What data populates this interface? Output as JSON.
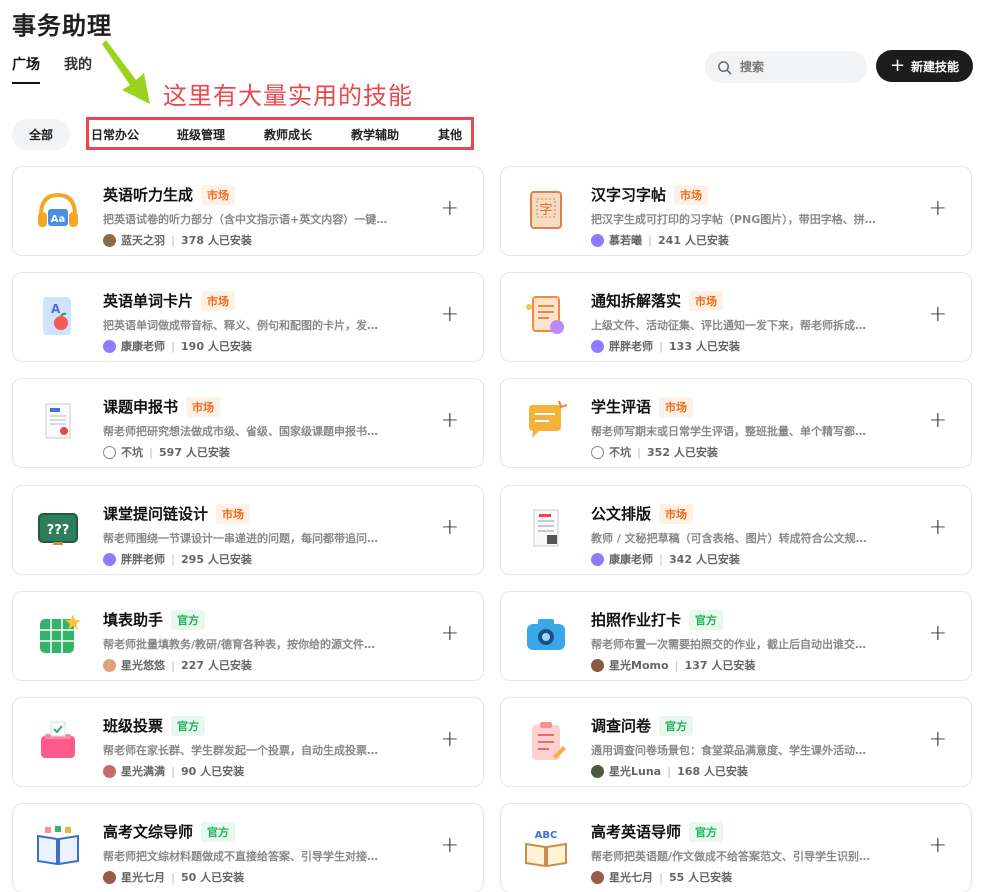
{
  "page_title": "事务助理",
  "tabs": [
    "广场",
    "我的"
  ],
  "search": {
    "placeholder": "搜索"
  },
  "new_button": "新建技能",
  "annotation": "这里有大量实用的技能",
  "filters": {
    "all": "全部",
    "items": [
      "日常办公",
      "班级管理",
      "教师成长",
      "教学辅助",
      "其他"
    ]
  },
  "colors": {
    "market_badge": "#f06a1b",
    "official_badge": "#1fb35a",
    "annotation": "#e8484e",
    "primary_button": "#1c1c1c"
  },
  "cards": [
    {
      "title": "英语听力生成",
      "badge": "市场",
      "badge_type": "market",
      "desc": "把英语试卷的听力部分（含中文指示语+英文内容）一键…",
      "author": "蓝天之羽",
      "installs": "378 人已安装",
      "icon": "headphones-icon"
    },
    {
      "title": "汉字习字帖",
      "badge": "市场",
      "badge_type": "market",
      "desc": "把汉字生成可打印的习字帖（PNG图片），带田字格、拼…",
      "author": "慕若曦",
      "installs": "241 人已安装",
      "icon": "character-copybook-icon"
    },
    {
      "title": "英语单词卡片",
      "badge": "市场",
      "badge_type": "market",
      "desc": "把英语单词做成带音标、释义、例句和配图的卡片，发…",
      "author": "康康老师",
      "installs": "190 人已安装",
      "icon": "word-card-icon"
    },
    {
      "title": "通知拆解落实",
      "badge": "市场",
      "badge_type": "market",
      "desc": "上级文件、活动征集、评比通知一发下来，帮老师拆成…",
      "author": "胖胖老师",
      "installs": "133 人已安装",
      "icon": "notice-icon"
    },
    {
      "title": "课题申报书",
      "badge": "市场",
      "badge_type": "market",
      "desc": "帮老师把研究想法做成市级、省级、国家级课题申报书…",
      "author": "不坑",
      "installs": "597 人已安装",
      "icon": "document-icon"
    },
    {
      "title": "学生评语",
      "badge": "市场",
      "badge_type": "market",
      "desc": "帮老师写期末或日常学生评语，整班批量、单个精写都…",
      "author": "不坑",
      "installs": "352 人已安装",
      "icon": "comment-icon"
    },
    {
      "title": "课堂提问链设计",
      "badge": "市场",
      "badge_type": "market",
      "desc": "帮老师围绕一节课设计一串递进的问题，每问都带追问…",
      "author": "胖胖老师",
      "installs": "295 人已安装",
      "icon": "blackboard-icon"
    },
    {
      "title": "公文排版",
      "badge": "市场",
      "badge_type": "market",
      "desc": "教师 / 文秘把草稿（可含表格、图片）转成符合公文规…",
      "author": "康康老师",
      "installs": "342 人已安装",
      "icon": "official-doc-icon"
    },
    {
      "title": "填表助手",
      "badge": "官方",
      "badge_type": "official",
      "desc": "帮老师批量填教务/教研/德育各种表，按你给的源文件…",
      "author": "星光悠悠",
      "installs": "227 人已安装",
      "icon": "table-icon"
    },
    {
      "title": "拍照作业打卡",
      "badge": "官方",
      "badge_type": "official",
      "desc": "帮老师布置一次需要拍照交的作业，截止后自动出谁交…",
      "author": "星光Momo",
      "installs": "137 人已安装",
      "icon": "camera-icon"
    },
    {
      "title": "班级投票",
      "badge": "官方",
      "badge_type": "official",
      "desc": "帮老师在家长群、学生群发起一个投票，自动生成投票…",
      "author": "星光满满",
      "installs": "90 人已安装",
      "icon": "ballot-box-icon"
    },
    {
      "title": "调查问卷",
      "badge": "官方",
      "badge_type": "official",
      "desc": "通用调查问卷场景包：食堂菜品满意度、学生课外活动…",
      "author": "星光Luna",
      "installs": "168 人已安装",
      "icon": "clipboard-icon"
    },
    {
      "title": "高考文综导师",
      "badge": "官方",
      "badge_type": "official",
      "desc": "帮老师把文综材料题做成不直接给答案、引导学生对接…",
      "author": "星光七月",
      "installs": "50 人已安装",
      "icon": "open-book-icon"
    },
    {
      "title": "高考英语导师",
      "badge": "官方",
      "badge_type": "official",
      "desc": "帮老师把英语题/作文做成不给答案范文、引导学生识别…",
      "author": "星光七月",
      "installs": "55 人已安装",
      "icon": "abc-book-icon"
    }
  ]
}
